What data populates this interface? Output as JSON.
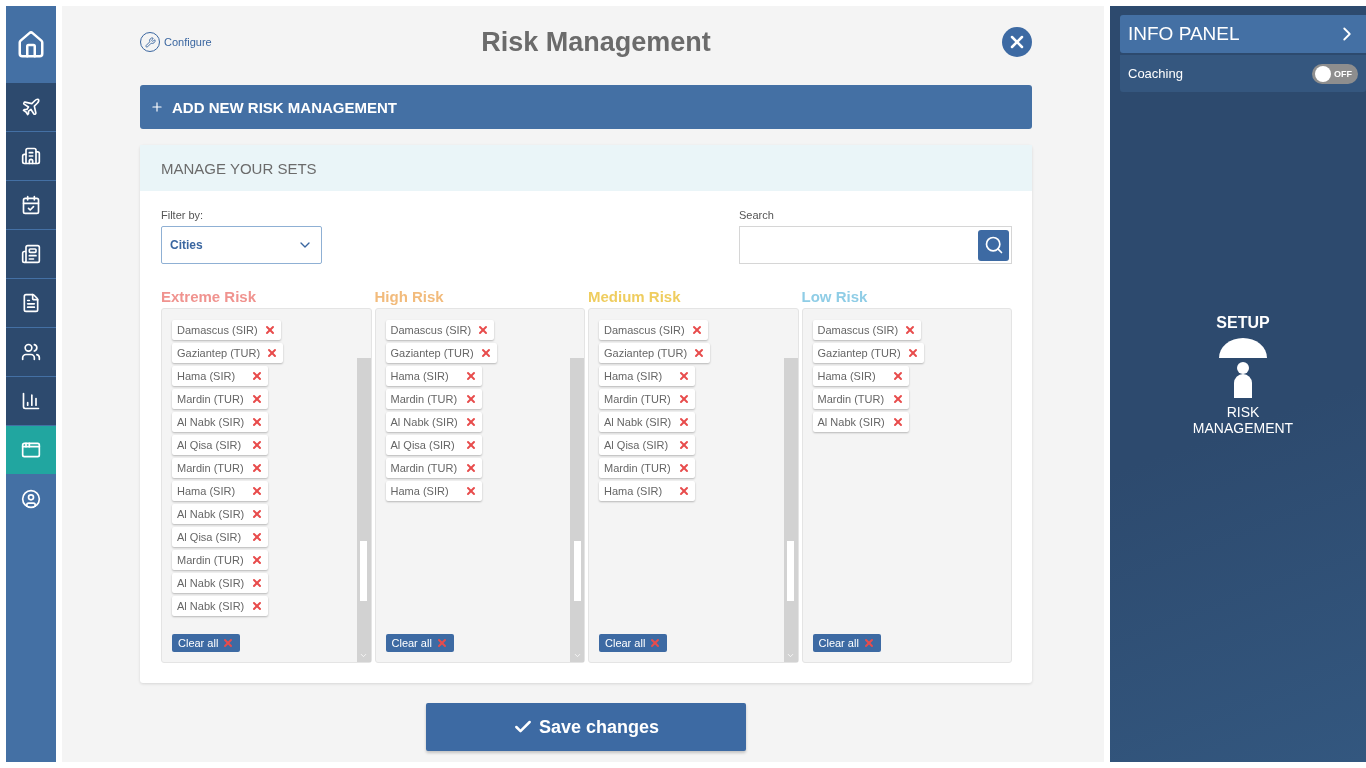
{
  "sidebar": {
    "items": [
      {
        "kind": "home",
        "selected": false
      },
      {
        "kind": "plane",
        "selected": false
      },
      {
        "kind": "building",
        "selected": false
      },
      {
        "kind": "calendar",
        "selected": false
      },
      {
        "kind": "newspaper",
        "selected": false
      },
      {
        "kind": "report",
        "selected": false
      },
      {
        "kind": "users",
        "selected": false
      },
      {
        "kind": "chart",
        "selected": false
      },
      {
        "kind": "window",
        "selected": true
      },
      {
        "kind": "profile",
        "selected": false
      }
    ]
  },
  "header": {
    "configure": "Configure",
    "title": "Risk Management"
  },
  "add_button": "ADD NEW RISK MANAGEMENT",
  "sets": {
    "title": "MANAGE YOUR SETS",
    "filter": {
      "label": "Filter by:",
      "value": "Cities"
    },
    "search": {
      "label": "Search"
    },
    "columns": [
      {
        "title": "Extreme Risk",
        "color": "#f0938f",
        "scrollable": true,
        "clear": "Clear all",
        "items": [
          "Damascus (SIR)",
          "Gaziantep (TUR)",
          "Hama (SIR)",
          "Mardin (TUR)",
          "Al Nabk (SIR)",
          "Al Qisa (SIR)",
          "Mardin (TUR)",
          "Hama (SIR)",
          "Al Nabk (SIR)",
          "Al Qisa (SIR)",
          "Mardin (TUR)",
          "Al Nabk (SIR)",
          "Al Nabk (SIR)"
        ]
      },
      {
        "title": "High Risk",
        "color": "#f2bb7c",
        "scrollable": true,
        "clear": "Clear all",
        "items": [
          "Damascus (SIR)",
          "Gaziantep (TUR)",
          "Hama (SIR)",
          "Mardin (TUR)",
          "Al Nabk (SIR)",
          "Al Qisa (SIR)",
          "Mardin (TUR)",
          "Hama (SIR)"
        ]
      },
      {
        "title": "Medium Risk",
        "color": "#efcd5f",
        "scrollable": true,
        "clear": "Clear all",
        "items": [
          "Damascus (SIR)",
          "Gaziantep (TUR)",
          "Hama (SIR)",
          "Mardin (TUR)",
          "Al Nabk (SIR)",
          "Al Qisa (SIR)",
          "Mardin (TUR)",
          "Hama (SIR)"
        ]
      },
      {
        "title": "Low Risk",
        "color": "#8fcde6",
        "scrollable": false,
        "clear": "Clear all",
        "items": [
          "Damascus (SIR)",
          "Gaziantep (TUR)",
          "Hama (SIR)",
          "Mardin (TUR)",
          "Al Nabk (SIR)"
        ]
      }
    ]
  },
  "save_button": "Save changes",
  "info_panel": {
    "title": "INFO PANEL",
    "coaching": {
      "label": "Coaching",
      "on": false,
      "state_text": "OFF"
    },
    "section": "SETUP",
    "caption": "RISK MANAGEMENT"
  }
}
